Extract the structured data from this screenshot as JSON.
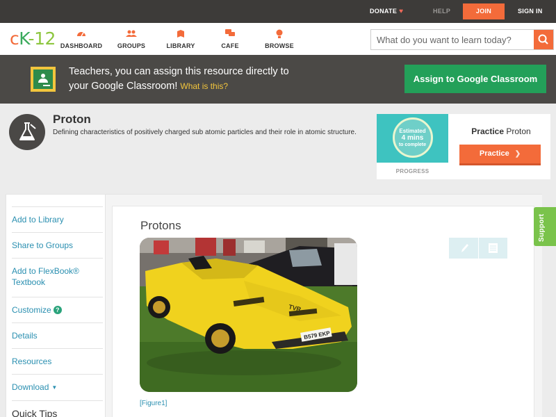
{
  "topbar": {
    "donate": "DONATE",
    "help": "HELP",
    "join": "JOIN",
    "sign_in": "SIGN IN"
  },
  "brand": {
    "logo_c": "c",
    "logo_k": "K",
    "logo_dash": "-",
    "logo_num": "12"
  },
  "nav": {
    "items": [
      {
        "label": "DASHBOARD",
        "icon": "dashboard-icon"
      },
      {
        "label": "GROUPS",
        "icon": "groups-icon"
      },
      {
        "label": "LIBRARY",
        "icon": "library-icon"
      },
      {
        "label": "CAFE",
        "icon": "cafe-icon"
      },
      {
        "label": "BROWSE",
        "icon": "browse-icon"
      }
    ],
    "search_placeholder": "What do you want to learn today?"
  },
  "banner": {
    "line1": "Teachers, you can assign this resource directly to",
    "line2": "your Google Classroom!",
    "what_link": "What is this?",
    "assign_button": "Assign to Google Classroom"
  },
  "concept": {
    "title": "Proton",
    "description": "Defining characteristics of positively charged sub atomic particles and their role in atomic structure."
  },
  "practice": {
    "estimated": "Estimated",
    "mins": "4 mins",
    "to_complete": "to complete",
    "progress_label": "PROGRESS",
    "title_bold": "Practice",
    "title_rest": "Proton",
    "button": "Practice"
  },
  "sidebar": {
    "items": [
      {
        "label": "Add to Library"
      },
      {
        "label": "Share to Groups"
      },
      {
        "label": "Add to FlexBook® Textbook"
      },
      {
        "label": "Customize",
        "badge": "?"
      },
      {
        "label": "Details"
      },
      {
        "label": "Resources"
      },
      {
        "label": "Download"
      }
    ],
    "quick_tips": "Quick Tips"
  },
  "content": {
    "title": "Protons",
    "figure_caption": "[Figure1]",
    "plate": "B579 EKP",
    "badge": "TVR"
  },
  "support": "Support",
  "colors": {
    "accent": "#f36b3a",
    "green": "#23a059",
    "link": "#2a8fb0",
    "dark": "#3d3b39"
  }
}
